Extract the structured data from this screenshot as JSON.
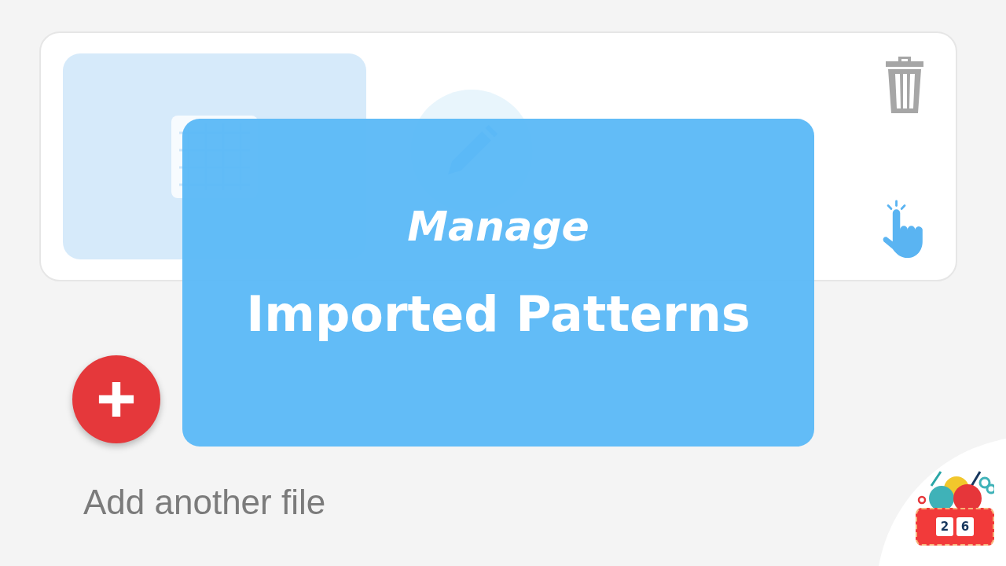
{
  "banner": {
    "subtitle": "Manage",
    "title": "Imported Patterns"
  },
  "add_file": {
    "label": "Add another file"
  },
  "logo": {
    "digits": [
      "2",
      "6"
    ]
  }
}
